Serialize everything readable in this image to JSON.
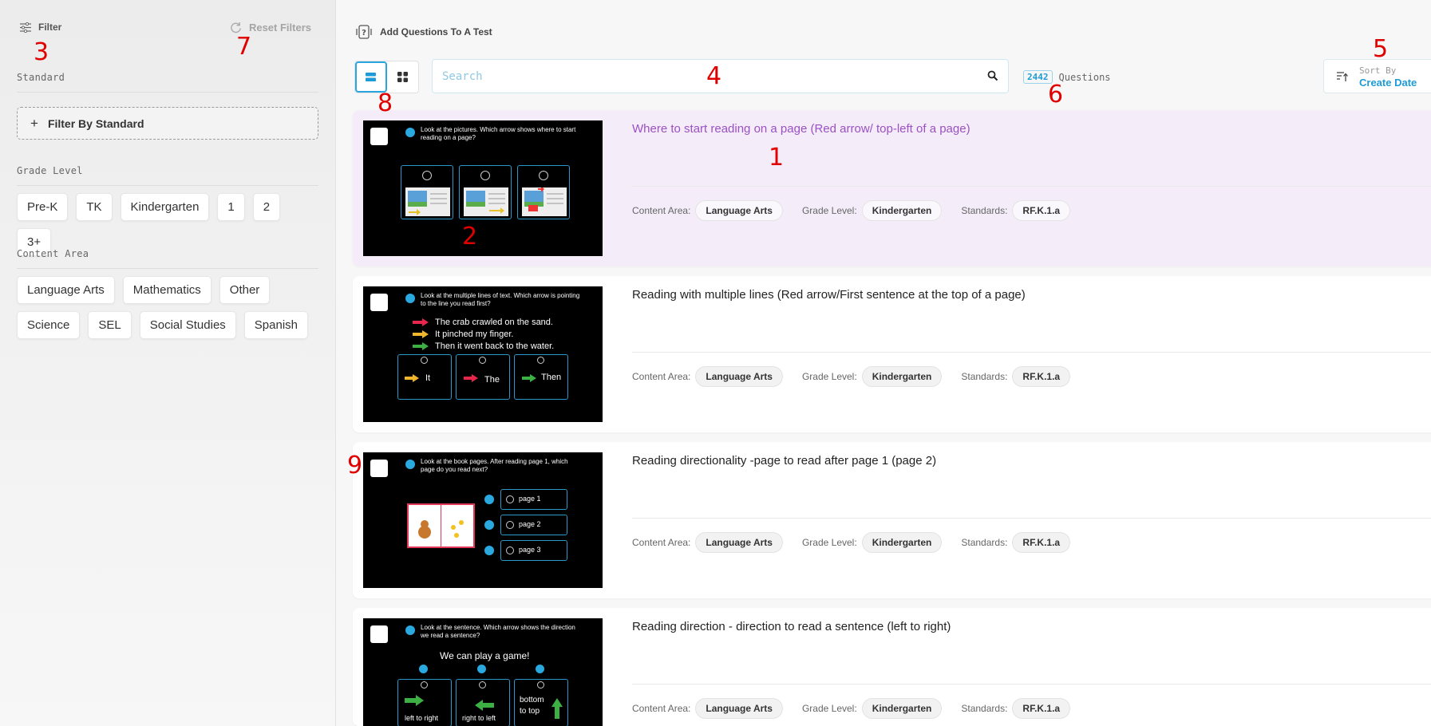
{
  "sidebar": {
    "filter_label": "Filter",
    "reset_label": "Reset Filters",
    "standard_label": "Standard",
    "filter_by_standard": "Filter By Standard",
    "grade_label": "Grade Level",
    "grades": [
      "Pre-K",
      "TK",
      "Kindergarten",
      "1",
      "2",
      "3+"
    ],
    "content_label": "Content Area",
    "content_areas": [
      "Language Arts",
      "Mathematics",
      "Other",
      "Science",
      "SEL",
      "Social Studies",
      "Spanish"
    ]
  },
  "header": {
    "breadcrumb": "Add Questions To A Test",
    "search_placeholder": "Search",
    "question_count": "2442",
    "questions_label": "Questions",
    "sort_label": "Sort By",
    "sort_value": "Create Date"
  },
  "meta_labels": {
    "content": "Content Area:",
    "grade": "Grade Level:",
    "standards": "Standards:"
  },
  "questions": [
    {
      "title": "Where to start reading on a page (Red arrow/ top-left of a page)",
      "content": "Language Arts",
      "grade": "Kindergarten",
      "standard": "RF.K.1.a",
      "prompt": "Look at the pictures. Which arrow shows where to start reading on a page?",
      "options": []
    },
    {
      "title": "Reading with multiple lines (Red arrow/First sentence at the top of a page)",
      "content": "Language Arts",
      "grade": "Kindergarten",
      "standard": "RF.K.1.a",
      "prompt": "Look at the multiple lines of text. Which arrow is pointing to the line you read first?",
      "lines": [
        "The crab crawled on the sand.",
        "It pinched my finger.",
        "Then it went back to the water."
      ],
      "options": [
        "It",
        "The",
        "Then"
      ]
    },
    {
      "title": "Reading directionality -page to read after page 1 (page 2)",
      "content": "Language Arts",
      "grade": "Kindergarten",
      "standard": "RF.K.1.a",
      "prompt": "Look at the book pages. After reading page 1, which page do you read next?",
      "options": [
        "page 1",
        "page 2",
        "page 3"
      ]
    },
    {
      "title": "Reading direction - direction to read a sentence (left to right)",
      "content": "Language Arts",
      "grade": "Kindergarten",
      "standard": "RF.K.1.a",
      "prompt": "Look at the sentence. Which arrow shows the direction we read a sentence?",
      "sentence": "We can play a game!",
      "options": [
        "left to right",
        "right to left",
        "bottom to top"
      ]
    }
  ],
  "annotations": [
    "1",
    "2",
    "3",
    "4",
    "5",
    "6",
    "7",
    "8",
    "9"
  ],
  "colors": {
    "accent": "#29a6df",
    "highlight": "#f4edf9",
    "title_highlight": "#9b50c4",
    "annotation": "#e00000"
  }
}
